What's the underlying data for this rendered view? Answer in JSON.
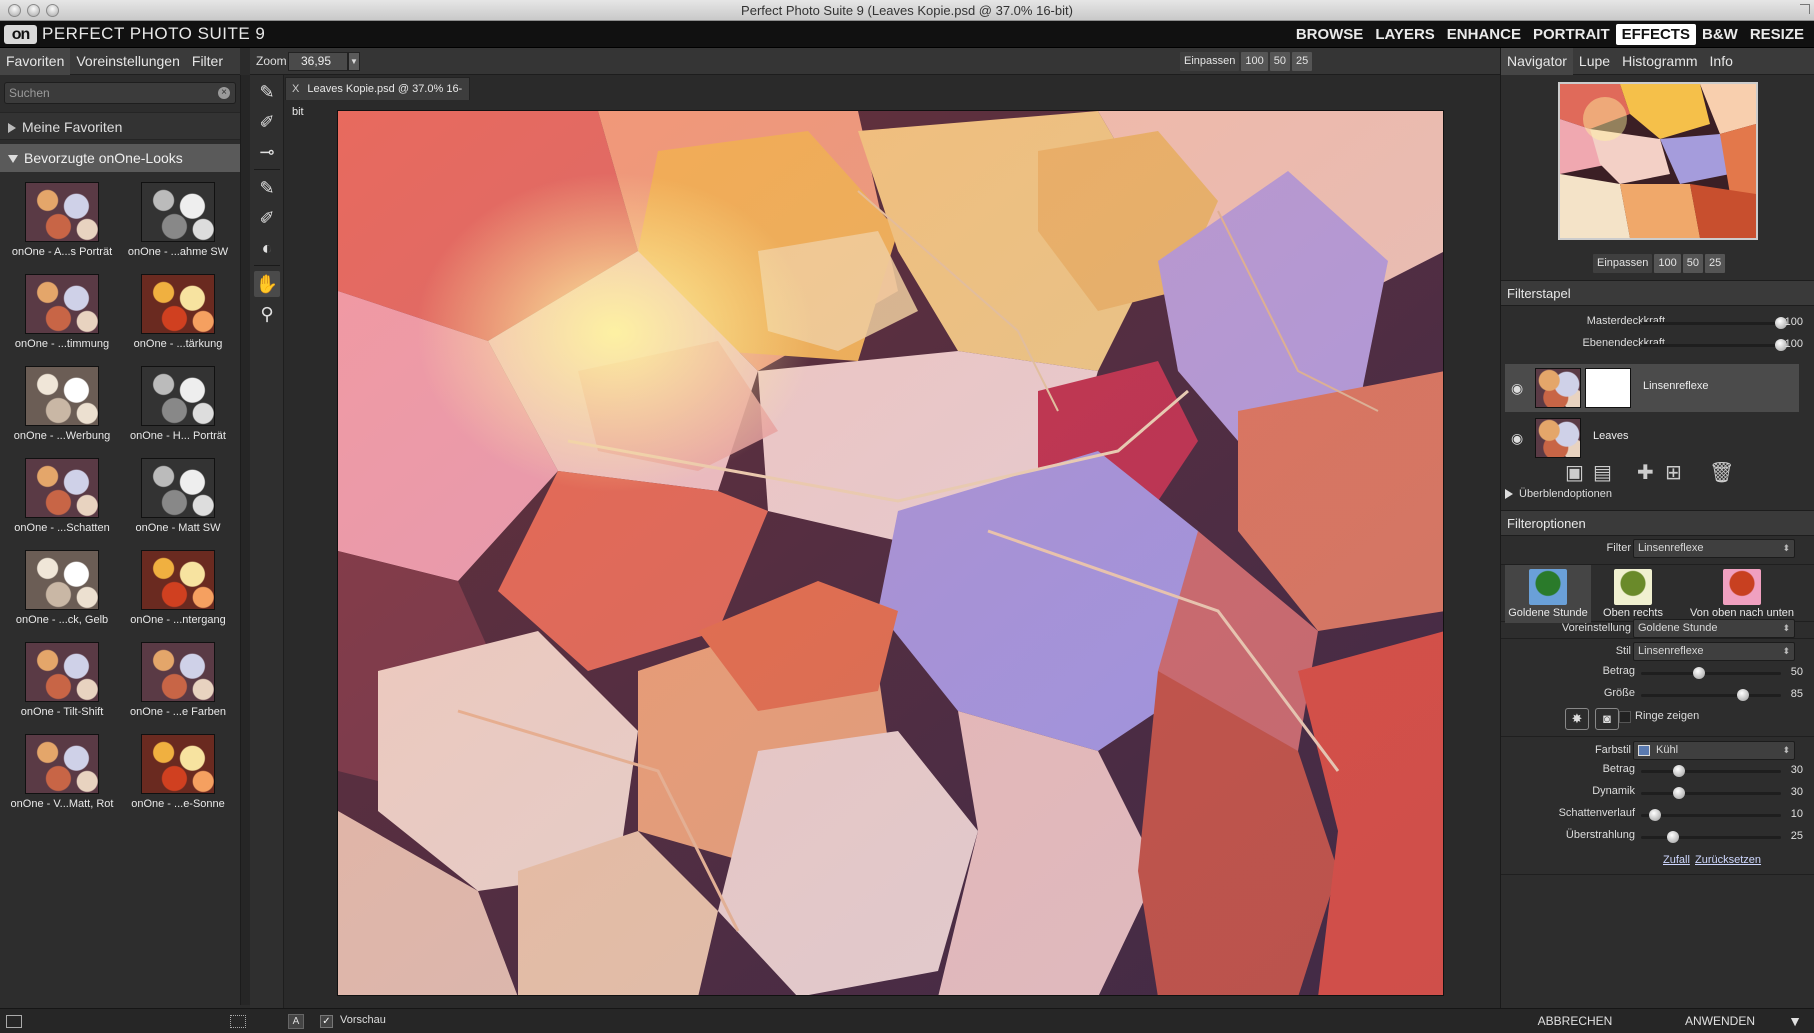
{
  "window": {
    "title": "Perfect Photo Suite 9 (Leaves Kopie.psd @ 37.0% 16-bit)"
  },
  "app": {
    "logo": "on",
    "name": "PERFECT PHOTO SUITE 9",
    "modules": [
      {
        "label": "BROWSE",
        "active": false
      },
      {
        "label": "LAYERS",
        "active": false
      },
      {
        "label": "ENHANCE",
        "active": false
      },
      {
        "label": "PORTRAIT",
        "active": false
      },
      {
        "label": "EFFECTS",
        "active": true
      },
      {
        "label": "B&W",
        "active": false
      },
      {
        "label": "RESIZE",
        "active": false
      }
    ]
  },
  "left_panel": {
    "tabs": [
      "Favoriten",
      "Voreinstellungen",
      "Filter"
    ],
    "search_placeholder": "Suchen",
    "sections": {
      "favorites": "Meine Favoriten",
      "looks": "Bevorzugte onOne-Looks"
    },
    "looks": [
      {
        "label": "onOne - A...s Porträt",
        "style": "color"
      },
      {
        "label": "onOne - ...ahme SW",
        "style": "bw"
      },
      {
        "label": "onOne - ...timmung",
        "style": "color"
      },
      {
        "label": "onOne - ...tärkung",
        "style": "warm"
      },
      {
        "label": "onOne - ...Werbung",
        "style": "pale"
      },
      {
        "label": "onOne - H... Porträt",
        "style": "bw"
      },
      {
        "label": "onOne - ...Schatten",
        "style": "color"
      },
      {
        "label": "onOne - Matt SW",
        "style": "bw"
      },
      {
        "label": "onOne - ...ck, Gelb",
        "style": "pale"
      },
      {
        "label": "onOne - ...ntergang",
        "style": "warm"
      },
      {
        "label": "onOne - Tilt-Shift",
        "style": "color"
      },
      {
        "label": "onOne - ...e Farben",
        "style": "color"
      },
      {
        "label": "onOne - V...Matt, Rot",
        "style": "color"
      },
      {
        "label": "onOne - ...e-Sonne",
        "style": "warm"
      }
    ]
  },
  "zoombar": {
    "label": "Zoom",
    "value": "36,95",
    "buttons": [
      "Einpassen",
      "100",
      "50",
      "25"
    ]
  },
  "document": {
    "tab_close": "X",
    "tab_label": "Leaves Kopie.psd @ 37.0% 16-bit"
  },
  "right_panel": {
    "tabs": [
      "Navigator",
      "Lupe",
      "Histogramm",
      "Info"
    ],
    "nav_buttons": [
      "Einpassen",
      "100",
      "50",
      "25"
    ],
    "filterstack": {
      "header": "Filterstapel",
      "master_label": "Masterdeckkraft",
      "master_value": "100",
      "layer_label": "Ebenendeckkraft",
      "layer_value": "100",
      "layers": [
        {
          "name": "Linsenreflexe",
          "active": true
        },
        {
          "name": "Leaves",
          "active": false
        }
      ],
      "blend_options": "Überblendoptionen"
    },
    "filteroptions": {
      "header": "Filteroptionen",
      "filter_label": "Filter",
      "filter_value": "Linsenreflexe",
      "presets": [
        "Goldene Stunde",
        "Oben rechts",
        "Von oben nach unten"
      ],
      "preset_label": "Voreinstellung",
      "preset_value": "Goldene Stunde",
      "style_label": "Stil",
      "style_value": "Linsenreflexe",
      "amount_label": "Betrag",
      "amount_value": "50",
      "size_label": "Größe",
      "size_value": "85",
      "rings_label": "Ringe zeigen",
      "colorstyle_label": "Farbstil",
      "colorstyle_value": "Kühl",
      "sliders2": [
        {
          "label": "Betrag",
          "value": "30"
        },
        {
          "label": "Dynamik",
          "value": "30"
        },
        {
          "label": "Schattenverlauf",
          "value": "10"
        },
        {
          "label": "Überstrahlung",
          "value": "25"
        }
      ],
      "random_link": "Zufall",
      "reset_link": "Zurücksetzen"
    }
  },
  "bottombar": {
    "preview_label": "Vorschau",
    "cancel": "ABBRECHEN",
    "apply": "ANWENDEN"
  }
}
